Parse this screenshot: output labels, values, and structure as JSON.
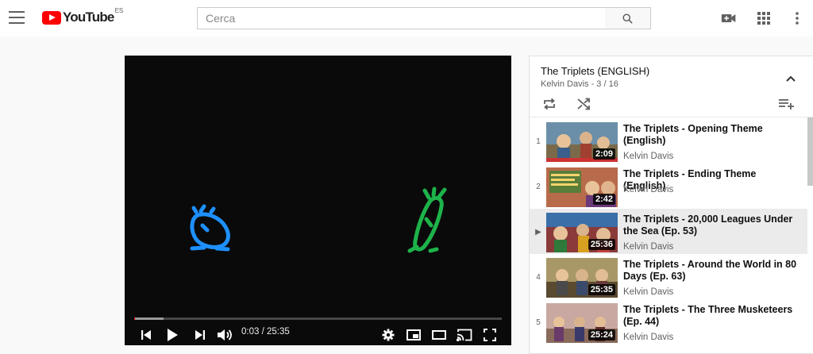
{
  "header": {
    "logo_text": "YouTube",
    "region_code": "ES",
    "search_placeholder": "Cerca"
  },
  "player": {
    "current_time": "0:03",
    "duration": "25:35",
    "time_display": "0:03 / 25:35",
    "played_fraction": 0.002,
    "loaded_fraction": 0.08
  },
  "playlist": {
    "title": "The Triplets (ENGLISH)",
    "owner": "Kelvin Davis",
    "position": "3 / 16",
    "subtitle": "Kelvin Davis - 3 / 16",
    "items": [
      {
        "index": "1",
        "title": "The Triplets - Opening Theme (English)",
        "channel": "Kelvin Davis",
        "duration": "2:09"
      },
      {
        "index": "2",
        "title": "The Triplets - Ending Theme (English)",
        "channel": "Kelvin Davis",
        "duration": "2:42"
      },
      {
        "index": "▶",
        "title": "The Triplets - 20,000 Leagues Under the Sea (Ep. 53)",
        "channel": "Kelvin Davis",
        "duration": "25:36"
      },
      {
        "index": "4",
        "title": "The Triplets - Around the World in 80 Days (Ep. 63)",
        "channel": "Kelvin Davis",
        "duration": "25:35"
      },
      {
        "index": "5",
        "title": "The Triplets - The Three Musketeers (Ep. 44)",
        "channel": "Kelvin Davis",
        "duration": "25:24"
      }
    ]
  },
  "colors": {
    "brand_red": "#ff0000",
    "active_row": "#ebebeb",
    "figure_blue": "#1e90ff",
    "figure_green": "#1db34a"
  }
}
